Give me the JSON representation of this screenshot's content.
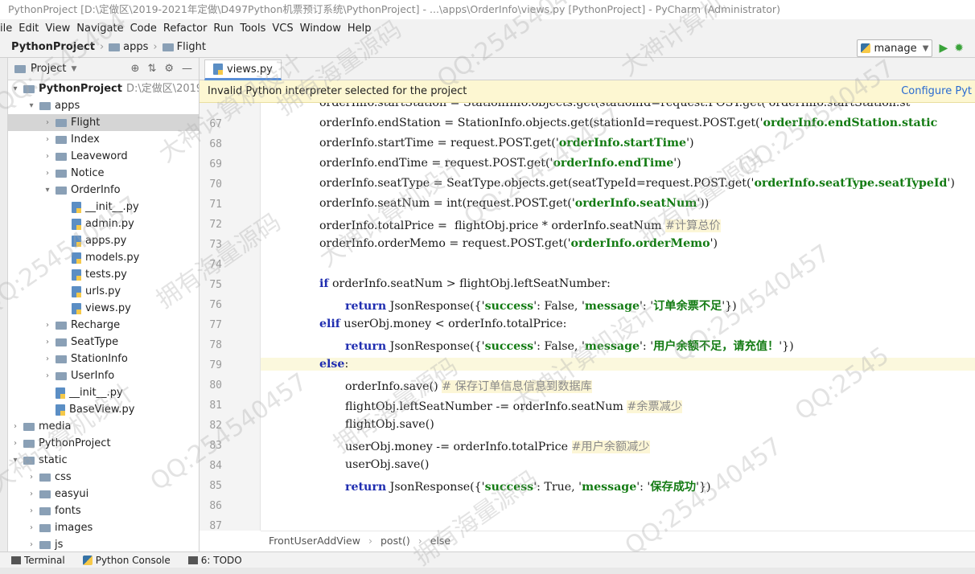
{
  "window": {
    "title": "PythonProject [D:\\定做区\\2019-2021年定做\\D497Python机票预订系统\\PythonProject] - ...\\apps\\OrderInfo\\views.py [PythonProject] - PyCharm (Administrator)"
  },
  "menu": [
    "ile",
    "Edit",
    "View",
    "Navigate",
    "Code",
    "Refactor",
    "Run",
    "Tools",
    "VCS",
    "Window",
    "Help"
  ],
  "nav": {
    "project": "PythonProject",
    "folder": "apps",
    "item": "Flight",
    "config": "manage"
  },
  "panel": {
    "title": "Project"
  },
  "tree": [
    {
      "label": "PythonProject",
      "extra": "D:\\定做区\\2019-20"
    },
    {
      "label": "apps"
    },
    {
      "label": "Flight"
    },
    {
      "label": "Index"
    },
    {
      "label": "Leaveword"
    },
    {
      "label": "Notice"
    },
    {
      "label": "OrderInfo"
    },
    {
      "label": "__init__.py"
    },
    {
      "label": "admin.py"
    },
    {
      "label": "apps.py"
    },
    {
      "label": "models.py"
    },
    {
      "label": "tests.py"
    },
    {
      "label": "urls.py"
    },
    {
      "label": "views.py"
    },
    {
      "label": "Recharge"
    },
    {
      "label": "SeatType"
    },
    {
      "label": "StationInfo"
    },
    {
      "label": "UserInfo"
    },
    {
      "label": "__init__.py"
    },
    {
      "label": "BaseView.py"
    },
    {
      "label": "media"
    },
    {
      "label": "PythonProject"
    },
    {
      "label": "static"
    },
    {
      "label": "css"
    },
    {
      "label": "easyui"
    },
    {
      "label": "fonts"
    },
    {
      "label": "images"
    },
    {
      "label": "js"
    }
  ],
  "tab": {
    "label": "views.py"
  },
  "warning": {
    "text": "Invalid Python interpreter selected for the project",
    "link": "Configure Pyt"
  },
  "code": {
    "lines": [
      {
        "n": "",
        "t": "orderInfo.startStation = StationInfo.objects.get(stationId=request.POST.get('orderInfo.startStation.st"
      },
      {
        "n": "67",
        "t": "orderInfo.endStation = StationInfo.objects.get(stationId=request.POST.get('",
        "s": "orderInfo.endStation.static"
      },
      {
        "n": "68",
        "t": "orderInfo.startTime = request.POST.get('",
        "s": "orderInfo.startTime",
        "e": "')"
      },
      {
        "n": "69",
        "t": "orderInfo.endTime = request.POST.get('",
        "s": "orderInfo.endTime",
        "e": "')"
      },
      {
        "n": "70",
        "t": "orderInfo.seatType = SeatType.objects.get(seatTypeId=request.POST.get('",
        "s": "orderInfo.seatType.seatTypeId",
        "e": "')"
      },
      {
        "n": "71",
        "t": "orderInfo.seatNum = int(request.POST.get('",
        "s": "orderInfo.seatNum",
        "e": "'))"
      },
      {
        "n": "72",
        "t": "orderInfo.totalPrice =  flightObj.price * orderInfo.seatNum ",
        "c": "#计算总价"
      },
      {
        "n": "73",
        "t": "orderInfo.orderMemo = request.POST.get('",
        "s": "orderInfo.orderMemo",
        "e": "')"
      },
      {
        "n": "74",
        "t": ""
      },
      {
        "n": "75",
        "k": "if",
        "t": " orderInfo.seatNum > flightObj.leftSeatNumber:"
      },
      {
        "n": "76",
        "k": "return",
        "t": " JsonResponse({'",
        "s": "success",
        "e": "': False, '",
        "s2": "message",
        "e2": "': '",
        "s3": "订单余票不足",
        "e3": "'})"
      },
      {
        "n": "77",
        "k": "elif",
        "t": " userObj.money < orderInfo.totalPrice:"
      },
      {
        "n": "78",
        "k": "return",
        "t": " JsonResponse({'",
        "s": "success",
        "e": "': False, '",
        "s2": "message",
        "e2": "': '",
        "s3": "用户余额不足，请充值！",
        "e3": "'})"
      },
      {
        "n": "79",
        "k": "else",
        "t": ":"
      },
      {
        "n": "80",
        "t": "orderInfo.save() ",
        "c": "# 保存订单信息信息到数据库"
      },
      {
        "n": "81",
        "t": "flightObj.leftSeatNumber -= orderInfo.seatNum ",
        "c": "#余票减少"
      },
      {
        "n": "82",
        "t": "flightObj.save()"
      },
      {
        "n": "83",
        "t": "userObj.money -= orderInfo.totalPrice ",
        "c": "#用户余额减少"
      },
      {
        "n": "84",
        "t": "userObj.save()"
      },
      {
        "n": "85",
        "k": "return",
        "t": " JsonResponse({'",
        "s": "success",
        "e": "': True, '",
        "s2": "message",
        "e2": "': '",
        "s3": "保存成功",
        "e3": "'})"
      },
      {
        "n": "86",
        "t": ""
      },
      {
        "n": "87",
        "t": ""
      }
    ]
  },
  "bottom_crumbs": [
    "FrontUserAddView",
    "post()",
    "else"
  ],
  "bottom_tools": [
    "Terminal",
    "Python Console",
    "6: TODO"
  ],
  "watermarks": [
    "QQ:2545404",
    "大神计算机设计",
    "拥有海量源码",
    "QQ:2545404",
    "大神计算机",
    "QQ:254540457",
    "拥有海量源码",
    "大神计算机设计",
    "QQ:254540457",
    "拥有海量源码",
    "QQ:254540457",
    "大神计算机设计",
    "QQ:254540457",
    "拥有海量源码",
    "QQ:2545",
    "大神计算机设计",
    "QQ:254540457",
    "拥有海量源码",
    "QQ:254540457"
  ]
}
